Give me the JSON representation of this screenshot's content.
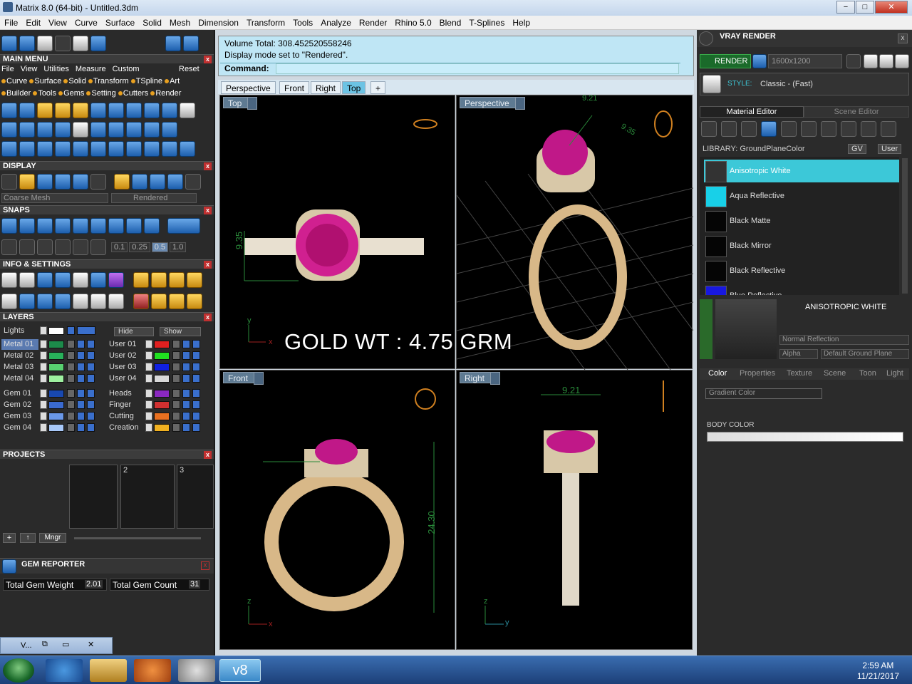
{
  "window": {
    "title": "Matrix 8.0 (64-bit) - Untitled.3dm",
    "min": "−",
    "max": "□",
    "close": "✕"
  },
  "menu": [
    "File",
    "Edit",
    "View",
    "Curve",
    "Surface",
    "Solid",
    "Mesh",
    "Dimension",
    "Transform",
    "Tools",
    "Analyze",
    "Render",
    "Rhino 5.0",
    "Blend",
    "T-Splines",
    "Help"
  ],
  "left": {
    "main_menu": {
      "title": "MAIN MENU",
      "row1": [
        "File",
        "View",
        "Utilities",
        "Measure",
        "Custom"
      ],
      "reset": "Reset",
      "row2": [
        "Curve",
        "Surface",
        "Solid",
        "Transform",
        "TSpline",
        "Art"
      ],
      "row3": [
        "Builder",
        "Tools",
        "Gems",
        "Setting",
        "Cutters",
        "Render"
      ]
    },
    "display": {
      "title": "DISPLAY",
      "mesh": "Coarse Mesh",
      "mode": "Rendered"
    },
    "snaps": {
      "title": "SNAPS",
      "values": [
        "0.1",
        "0.25",
        "0.5",
        "1.0"
      ]
    },
    "info": {
      "title": "INFO & SETTINGS"
    },
    "layers": {
      "title": "LAYERS",
      "lights": "Lights",
      "hide": "Hide",
      "show": "Show",
      "col1": [
        {
          "name": "Metal 01",
          "color": "#1c8a4a"
        },
        {
          "name": "Metal 02",
          "color": "#28b05a"
        },
        {
          "name": "Metal 03",
          "color": "#58d070"
        },
        {
          "name": "Metal 04",
          "color": "#9ef0a0"
        },
        {
          "name": "Gem 01",
          "color": "#1848b0"
        },
        {
          "name": "Gem 02",
          "color": "#3a6ad0"
        },
        {
          "name": "Gem 03",
          "color": "#6a98e8"
        },
        {
          "name": "Gem 04",
          "color": "#a8c8f8"
        }
      ],
      "col2": [
        {
          "name": "User 01",
          "color": "#e02020"
        },
        {
          "name": "User 02",
          "color": "#20e020"
        },
        {
          "name": "User 03",
          "color": "#1020e0"
        },
        {
          "name": "User 04",
          "color": "#d8d8d8"
        },
        {
          "name": "Heads",
          "color": "#8a28c0"
        },
        {
          "name": "Finger",
          "color": "#d03030"
        },
        {
          "name": "Cutting",
          "color": "#e87020"
        },
        {
          "name": "Creation",
          "color": "#f0b020"
        }
      ]
    },
    "projects": {
      "title": "PROJECTS",
      "slots": [
        "",
        "2",
        "3"
      ],
      "mngr": "Mngr"
    },
    "gem_reporter": {
      "title": "GEM REPORTER",
      "weight_label": "Total Gem Weight",
      "weight": "2.01",
      "count_label": "Total Gem Count",
      "count": "31"
    },
    "mini": {
      "label": "V..."
    }
  },
  "command": {
    "line1": "Volume Total: 308.452520558246",
    "line2": "Display mode set to \"Rendered\".",
    "prompt": "Command:"
  },
  "tabs": [
    "Perspective",
    "Front",
    "Right",
    "Top",
    "+"
  ],
  "viewports": {
    "top": "Top",
    "perspective": "Perspective",
    "front": "Front",
    "right": "Right"
  },
  "dims": {
    "top": "9.35",
    "front": "24.30",
    "right": "9.21",
    "persp_a": "9.21",
    "persp_b": "9.35"
  },
  "overlay": "GOLD WT : 4.75 GRM",
  "axes": {
    "x": "x",
    "y": "y",
    "z": "z"
  },
  "right": {
    "title": "VRAY RENDER",
    "render": "RENDER",
    "resolution": "1600x1200",
    "style_label": "STYLE:",
    "style": "Classic - (Fast)",
    "tabs": [
      "Material Editor",
      "Scene Editor"
    ],
    "library": "LIBRARY: GroundPlaneColor",
    "gv": "GV",
    "user": "User",
    "materials": [
      {
        "name": "Anisotropic White",
        "color": "#333"
      },
      {
        "name": "Aqua Reflective",
        "color": "#18d0e8"
      },
      {
        "name": "Black Matte",
        "color": "#050505"
      },
      {
        "name": "Black Mirror",
        "color": "#050505"
      },
      {
        "name": "Black Reflective",
        "color": "#050505"
      },
      {
        "name": "Blue Reflective",
        "color": "#1818e0"
      }
    ],
    "preview_title": "ANISOTROPIC WHITE",
    "reflection": "Normal Reflection",
    "alpha": "Alpha",
    "ground": "Default Ground Plane",
    "prop_tabs": [
      "Color",
      "Properties",
      "Texture",
      "Scene",
      "Toon",
      "Light"
    ],
    "gradient": "Gradient Color",
    "body_color": "BODY COLOR"
  },
  "taskbar": {
    "app": "v8",
    "time": "2:59 AM",
    "date": "11/21/2017"
  }
}
